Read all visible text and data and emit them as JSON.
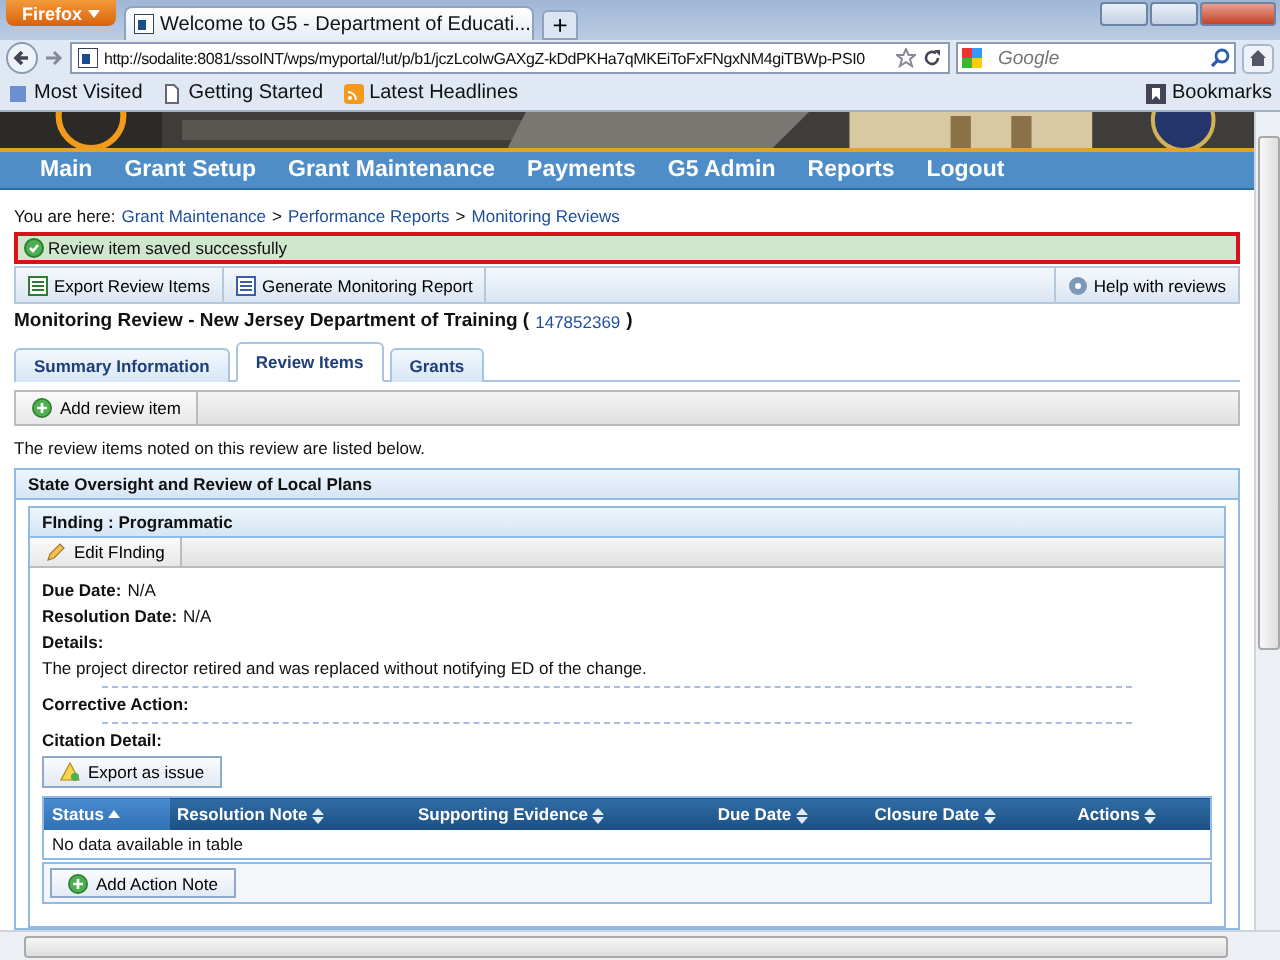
{
  "browser": {
    "menu_button": "Firefox",
    "tab_title": "Welcome to G5 - Department of Educati...",
    "new_tab": "+",
    "url": "http://sodalite:8081/ssoINT/wps/myportal/!ut/p/b1/jczLcoIwGAXgZ-kDdPKHa7qMKEiToFxFNgxNM4giTBWp-PSI0",
    "search_placeholder": "Google",
    "bookmarks": [
      "Most Visited",
      "Getting Started",
      "Latest Headlines"
    ],
    "bookmarks_menu": "Bookmarks"
  },
  "nav": {
    "items": [
      "Main",
      "Grant Setup",
      "Grant Maintenance",
      "Payments",
      "G5 Admin",
      "Reports",
      "Logout"
    ]
  },
  "breadcrumb": {
    "prefix": "You are here:",
    "items": [
      {
        "kind": "link",
        "text": "Grant Maintenance"
      },
      {
        "kind": "separator",
        "text": ">"
      },
      {
        "kind": "link",
        "text": "Performance Reports"
      },
      {
        "kind": "separator",
        "text": ">"
      },
      {
        "kind": "link",
        "text": "Monitoring Reviews"
      }
    ]
  },
  "message": "Review item saved successfully",
  "toolbar": {
    "buttons": [
      "Export Review Items",
      "Generate Monitoring Report"
    ],
    "help": "Help with reviews"
  },
  "title": {
    "text": "Monitoring Review - New Jersey Department of Training (",
    "id": "147852369",
    "close": ")"
  },
  "tabs": [
    {
      "label": "Summary Information",
      "selected": false
    },
    {
      "label": "Review Items",
      "selected": true
    },
    {
      "label": "Grants",
      "selected": false
    }
  ],
  "add_button": "Add review item",
  "intro": "The review items noted on this review are listed below.",
  "section": {
    "title": "State Oversight and Review of Local Plans",
    "finding": {
      "title": "FInding : Programmatic",
      "edit_button": "Edit FInding",
      "due_date": {
        "label": "Due Date:",
        "value": "N/A"
      },
      "resolution_date": {
        "label": "Resolution Date:",
        "value": "N/A"
      },
      "details_label": "Details:",
      "details": "The project director retired and was replaced without notifying ED of the change.",
      "corrective_label": "Corrective Action:",
      "citation_label": "Citation Detail:",
      "export_button": "Export as issue",
      "table": {
        "columns": [
          {
            "label": "Status",
            "sorted": true
          },
          {
            "label": "Resolution Note",
            "sorted": false
          },
          {
            "label": "Supporting Evidence",
            "sorted": false
          },
          {
            "label": "Due Date",
            "sorted": false
          },
          {
            "label": "Closure Date",
            "sorted": false
          },
          {
            "label": "Actions",
            "sorted": false
          }
        ],
        "empty_text": "No data available in table"
      },
      "add_note_button": "Add Action Note"
    }
  }
}
